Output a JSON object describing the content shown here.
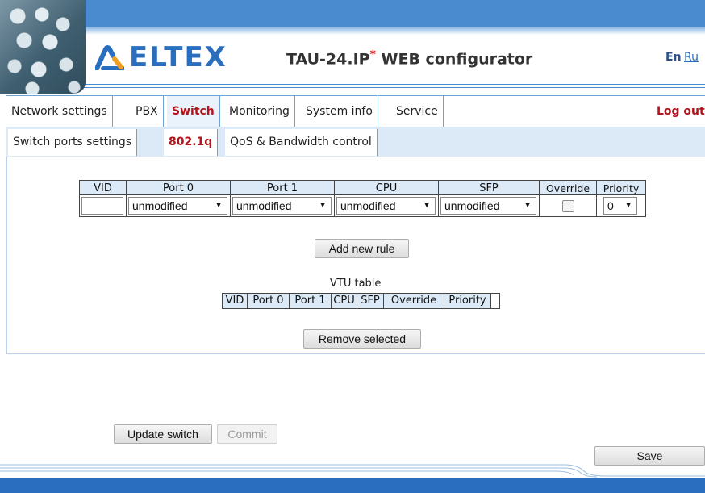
{
  "header": {
    "logo_text": "ELTEX",
    "product": "TAU-24.IP",
    "product_star": "*",
    "product_suffix": " WEB configurator",
    "lang_en": "En",
    "lang_ru": "Ru"
  },
  "topnav": {
    "tabs": [
      "Network settings",
      "PBX",
      "Switch",
      "Monitoring",
      "System info",
      "Service"
    ],
    "active": "Switch",
    "logout": "Log out"
  },
  "subnav": {
    "tabs": [
      "Switch ports settings",
      "802.1q",
      "QoS & Bandwidth control"
    ],
    "active": "802.1q"
  },
  "vlan_rule": {
    "headers": [
      "VID",
      "Port 0",
      "Port 1",
      "CPU",
      "SFP",
      "Override",
      "Priority"
    ],
    "vid_value": "",
    "port0": "unmodified",
    "port1": "unmodified",
    "cpu": "unmodified",
    "sfp": "unmodified",
    "override_checked": false,
    "priority": "0",
    "add_button": "Add new rule"
  },
  "vtu_table": {
    "caption": "VTU table",
    "headers": [
      "VID",
      "Port 0",
      "Port 1",
      "CPU",
      "SFP",
      "Override",
      "Priority"
    ],
    "remove_button": "Remove selected"
  },
  "actions": {
    "update": "Update switch",
    "commit": "Commit",
    "save": "Save"
  },
  "colors": {
    "accent_blue": "#2a6fbf",
    "active_tab_red": "#b1141c",
    "header_fill": "#dceaf8"
  }
}
